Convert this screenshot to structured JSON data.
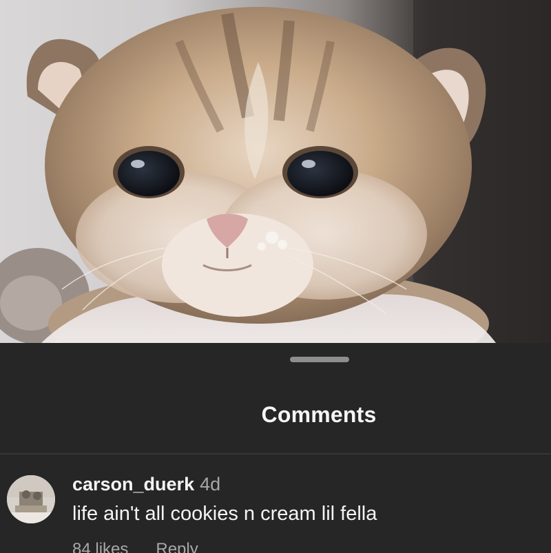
{
  "photo": {
    "description_icon": "kitten-photo"
  },
  "sheet": {
    "title": "Comments"
  },
  "comment": {
    "username": "carson_duerk",
    "timestamp": "4d",
    "text": "life ain't all cookies n cream lil fella",
    "likes": "84 likes",
    "reply": "Reply"
  },
  "colors": {
    "background": "#262626",
    "text_primary": "#f5f5f5",
    "text_secondary": "#a8a8a8",
    "handle": "#8e8e8e"
  }
}
